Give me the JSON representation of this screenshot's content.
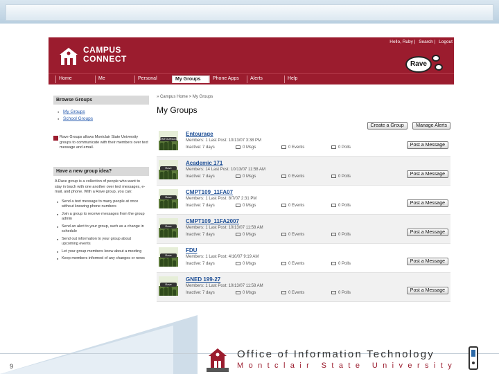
{
  "slide": {
    "page_number": "9"
  },
  "header": {
    "logo_line1": "CAMPUS",
    "logo_line2": "CONNECT",
    "user_links": [
      "Hello, Ruby",
      "Search",
      "Logout"
    ],
    "rave_label": "Rave"
  },
  "nav": {
    "items": [
      {
        "label": "Home"
      },
      {
        "label": "Me"
      },
      {
        "label": "Personal"
      },
      {
        "label": "My Groups",
        "active": true
      },
      {
        "label": "Phone Apps"
      },
      {
        "label": "Alerts"
      },
      {
        "label": "Help"
      }
    ]
  },
  "sidebar": {
    "browse_title": "Browse Groups",
    "browse_items": [
      "My Groups",
      "School Groups"
    ],
    "msu_text": "Rave Groups allows Montclair State University groups to communicate with their members over text message and email.",
    "idea_title": "Have a new group idea?",
    "idea_intro": "A Rave group is a collection of people who want to stay in touch with one another over text messages, e-mail, and phone. With a Rave group, you can:",
    "idea_items": [
      "Send a text message to many people at once without knowing phone numbers",
      "Join a group to receive messages from the group admin",
      "Send an alert to your group, such as a change in schedule",
      "Send out information to your group about upcoming events",
      "Let your group members know about a meeting",
      "Keep members informed of any changes or news"
    ]
  },
  "main": {
    "breadcrumb": "» Campus Home > My Groups",
    "title": "My Groups",
    "create_group_label": "Create a Group",
    "manage_alerts_label": "Manage Alerts",
    "post_message_label": "Post a Message",
    "groups": [
      {
        "name": "Entourage",
        "meta": "Members: 1   Last Post: 10/13/07 3:38 PM",
        "inactive": "Inactive: 7 days",
        "msgs": "0 Msgs",
        "events": "0 Events",
        "polls": "0 Polls",
        "thumb_caption": "ENTOURAGE"
      },
      {
        "name": "Academic 171",
        "meta": "Members: 14   Last Post: 10/13/07 11:58 AM",
        "inactive": "Inactive: 7 days",
        "msgs": "0 Msgs",
        "events": "0 Events",
        "polls": "0 Polls",
        "thumb_caption": "Rave"
      },
      {
        "name": "CMPT109_11FA07",
        "meta": "Members: 1   Last Post: 8/7/07 2:31 PM",
        "inactive": "Inactive: 7 days",
        "msgs": "0 Msgs",
        "events": "0 Events",
        "polls": "0 Polls",
        "thumb_caption": "Rave"
      },
      {
        "name": "CMPT109_11FA2007",
        "meta": "Members: 1   Last Post: 10/13/07 11:58 AM",
        "inactive": "Inactive: 7 days",
        "msgs": "0 Msgs",
        "events": "0 Events",
        "polls": "0 Polls",
        "thumb_caption": "Rave"
      },
      {
        "name": "FDU",
        "meta": "Members: 1   Last Post: 4/10/07 9:19 AM",
        "inactive": "Inactive: 7 days",
        "msgs": "0 Msgs",
        "events": "0 Events",
        "polls": "0 Polls",
        "thumb_caption": "Rave"
      },
      {
        "name": "GNED 199-27",
        "meta": "Members: 1   Last Post: 10/13/07 11:58 AM",
        "inactive": "Inactive: 7 days",
        "msgs": "0 Msgs",
        "events": "0 Events",
        "polls": "0 Polls",
        "thumb_caption": "Rave"
      }
    ]
  },
  "footer": {
    "line1": "Office of Information Technology",
    "line2": "Montclair State University"
  },
  "colors": {
    "brand": "#9b1c2e",
    "link": "#1e4f96"
  }
}
